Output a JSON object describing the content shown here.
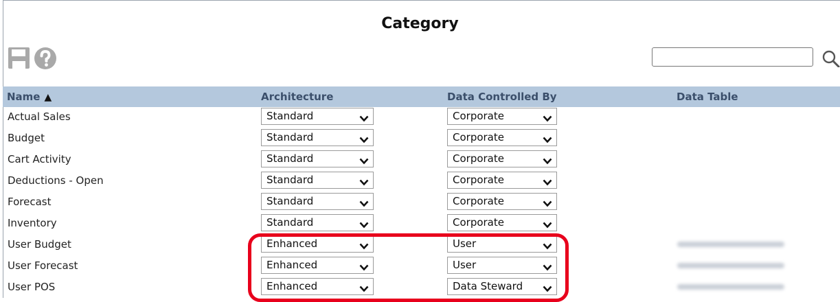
{
  "page": {
    "title": "Category"
  },
  "toolbar": {
    "save_icon": "save-icon",
    "help_icon": "help-icon",
    "search_placeholder": ""
  },
  "columns": {
    "name": "Name",
    "architecture": "Architecture",
    "data_controlled_by": "Data Controlled By",
    "data_table": "Data Table"
  },
  "sort": {
    "column": "Name",
    "direction": "ascending",
    "icon": "▲"
  },
  "rows": [
    {
      "name": "Actual Sales",
      "architecture": "Standard",
      "controlled_by": "Corporate"
    },
    {
      "name": "Budget",
      "architecture": "Standard",
      "controlled_by": "Corporate"
    },
    {
      "name": "Cart Activity",
      "architecture": "Standard",
      "controlled_by": "Corporate"
    },
    {
      "name": "Deductions - Open",
      "architecture": "Standard",
      "controlled_by": "Corporate"
    },
    {
      "name": "Forecast",
      "architecture": "Standard",
      "controlled_by": "Corporate"
    },
    {
      "name": "Inventory",
      "architecture": "Standard",
      "controlled_by": "Corporate"
    },
    {
      "name": "User Budget",
      "architecture": "Enhanced",
      "controlled_by": "User"
    },
    {
      "name": "User Forecast",
      "architecture": "Enhanced",
      "controlled_by": "User"
    },
    {
      "name": "User POS",
      "architecture": "Enhanced",
      "controlled_by": "Data Steward"
    }
  ],
  "colors": {
    "header_bg": "#b4c8dd",
    "header_text": "#3b4f6b",
    "highlight": "#e8001c",
    "icon_gray": "#a9a9a9"
  }
}
